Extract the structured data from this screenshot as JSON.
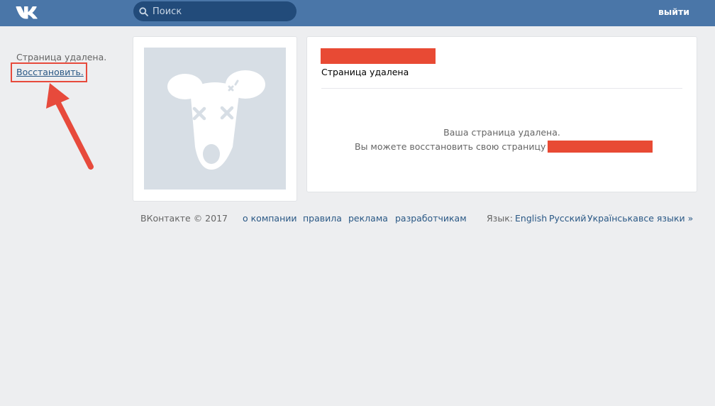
{
  "header": {
    "search_placeholder": "Поиск",
    "logout_label": "выйти",
    "logo_icon": "vk-logo-icon",
    "search_icon": "search-icon"
  },
  "sidebar": {
    "status_text": "Страница удалена.",
    "restore_link": "Восстановить."
  },
  "profile": {
    "status": "Страница удалена",
    "message_line1": "Ваша страница удалена.",
    "message_line2": "Вы можете восстановить свою страницу до"
  },
  "footer": {
    "copyright": "ВКонтакте © 2017",
    "links": [
      "о компании",
      "правила",
      "реклама",
      "разработчикам"
    ],
    "language_label": "Язык:",
    "languages": [
      "English",
      "Русский",
      "Українська",
      "все языки »"
    ]
  },
  "colors": {
    "header_bg": "#4a76a8",
    "page_bg": "#edeef0",
    "link": "#2a5885",
    "annotation_red": "#e74a3c"
  }
}
